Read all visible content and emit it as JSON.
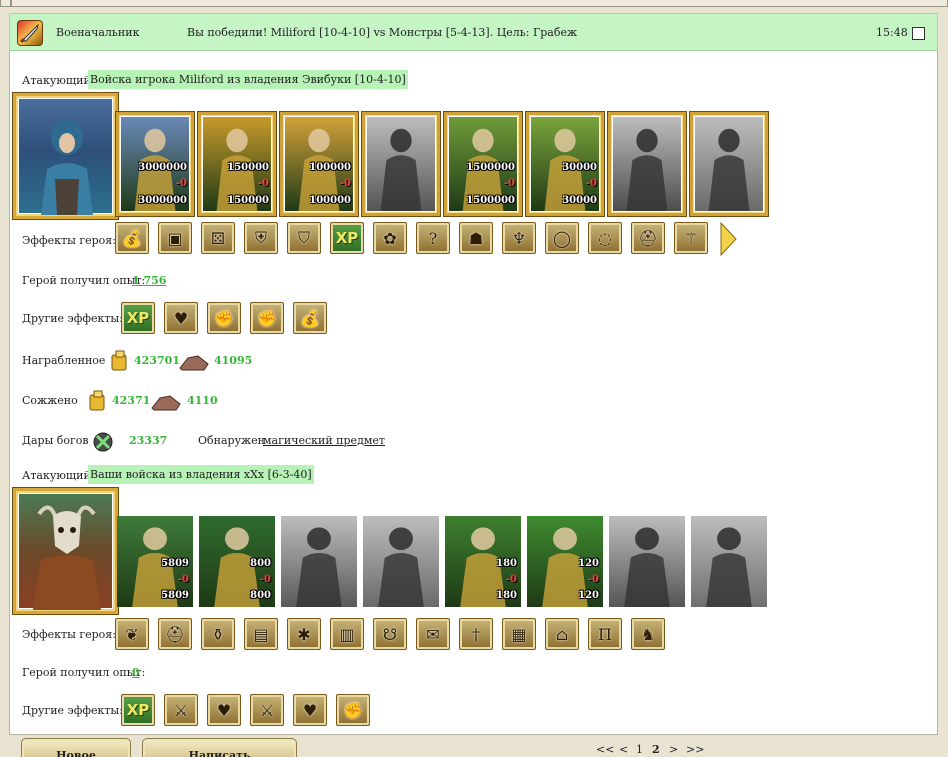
{
  "header": {
    "role": "Военачальник",
    "message": "Вы победили! Miliford [10-4-10] vs Монстры [5-4-13]. Цель: Грабеж",
    "time": "15:48"
  },
  "side1": {
    "label": "Атакующий",
    "title": "Войска игрока Miliford из владения Эвибуки [10-4-10]",
    "units": [
      {
        "name": "unit-1",
        "top": "3000000",
        "loss": "-0",
        "bottom": "3000000",
        "color": "#6a89b9"
      },
      {
        "name": "unit-2",
        "top": "150000",
        "loss": "-0",
        "bottom": "150000",
        "color": "#c79a2a"
      },
      {
        "name": "unit-3",
        "top": "100000",
        "loss": "-0",
        "bottom": "100000",
        "color": "#d2a23a"
      },
      {
        "name": "unit-4",
        "top": "",
        "loss": "",
        "bottom": "",
        "color": "#555555"
      },
      {
        "name": "unit-5",
        "top": "1500000",
        "loss": "-0",
        "bottom": "1500000",
        "color": "#6f9b3a"
      },
      {
        "name": "unit-6",
        "top": "30000",
        "loss": "-0",
        "bottom": "30000",
        "color": "#7aa43c"
      },
      {
        "name": "unit-7",
        "top": "",
        "loss": "",
        "bottom": "",
        "color": "#4d4d4d"
      },
      {
        "name": "unit-8",
        "top": "",
        "loss": "",
        "bottom": "",
        "color": "#6a6a6a"
      }
    ],
    "effects_label": "Эффекты героя:",
    "exp_label": "Герой получил опыт:",
    "exp_value": "1 756",
    "other_label": "Другие эффекты:",
    "loot_label": "Награбленное",
    "loot_gold": "423701",
    "loot_ore": "41095",
    "burned_label": "Сожжено",
    "burned_gold": "42371",
    "burned_ore": "4110",
    "gods_label": "Дары богов",
    "gods_value": "23337",
    "found_label": "Обнаружен",
    "found_value": "магический предмет"
  },
  "side2": {
    "label": "Атакующий",
    "title": "Ваши войска из владения xXx [6-3-40]",
    "units": [
      {
        "name": "unit-1",
        "top": "5809",
        "loss": "-0",
        "bottom": "5809",
        "color": "#3f7b3a"
      },
      {
        "name": "unit-2",
        "top": "800",
        "loss": "-0",
        "bottom": "800",
        "color": "#2f6b2e"
      },
      {
        "name": "unit-3",
        "top": "",
        "loss": "",
        "bottom": "",
        "color": "#595959"
      },
      {
        "name": "unit-4",
        "top": "",
        "loss": "",
        "bottom": "",
        "color": "#6a6a6a"
      },
      {
        "name": "unit-5",
        "top": "180",
        "loss": "-0",
        "bottom": "180",
        "color": "#3d7f2f"
      },
      {
        "name": "unit-6",
        "top": "120",
        "loss": "-0",
        "bottom": "120",
        "color": "#3e8b2f"
      },
      {
        "name": "unit-7",
        "top": "",
        "loss": "",
        "bottom": "",
        "color": "#555555"
      },
      {
        "name": "unit-8",
        "top": "",
        "loss": "",
        "bottom": "",
        "color": "#6f6f6f"
      }
    ],
    "effects_label": "Эффекты героя:",
    "exp_label": "Герой получил опыт:",
    "exp_value": "0",
    "other_label": "Другие эффекты:"
  },
  "buttons": {
    "new_message": "Новое сообщение",
    "write_admin": "Написать администрации"
  },
  "pager": {
    "first": "<<",
    "prev": "<",
    "p1": "1",
    "p2": "2",
    "next": ">",
    "last": ">>"
  },
  "colors": {
    "header_bg": "#c6f5c5",
    "highlight": "#b7f2b6",
    "value_green": "#36b536",
    "loss_red": "#ff3b3b",
    "frame_gold": "#d7a93a"
  },
  "icons": {
    "hero1_effects": [
      "gold-bag-icon",
      "chest-icon",
      "dice-icon",
      "shield-icon",
      "handshake-shield-icon",
      "xp-icon",
      "xp-plant-icon",
      "question-icon",
      "beetle-icon",
      "antlers-icon",
      "ring-icon",
      "ring-purple-icon",
      "helmet-icon",
      "scepter-icon"
    ],
    "hero1_other": [
      "xp-icon",
      "hearts-armor-icon",
      "fist-sword-icon",
      "fist-sword-icon",
      "gold-bag-icon"
    ],
    "hero2_effects": [
      "leaf-helmet-icon",
      "helmet-icon",
      "potion-icon",
      "armor-icon",
      "web-shield-icon",
      "bracer-icon",
      "hood-icon",
      "scroll-icon",
      "dagger-icon",
      "cage-icon",
      "cloak-icon",
      "pants-icon",
      "camel-icon"
    ],
    "hero2_other": [
      "xp-icon",
      "sword-icon",
      "hearts-armor-icon",
      "sword-icon",
      "hearts-armor-icon",
      "fist-sword-icon"
    ]
  }
}
